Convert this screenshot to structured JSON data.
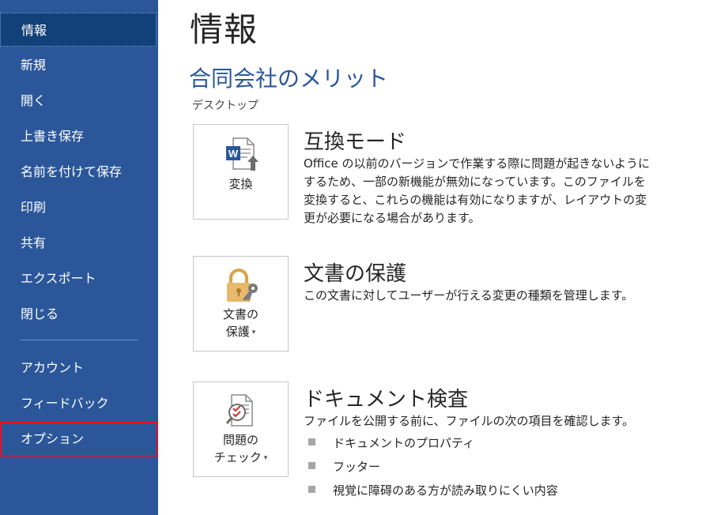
{
  "sidebar": {
    "items": [
      {
        "label": "情報"
      },
      {
        "label": "新規"
      },
      {
        "label": "開く"
      },
      {
        "label": "上書き保存"
      },
      {
        "label": "名前を付けて保存"
      },
      {
        "label": "印刷"
      },
      {
        "label": "共有"
      },
      {
        "label": "エクスポート"
      },
      {
        "label": "閉じる"
      },
      {
        "label": "アカウント"
      },
      {
        "label": "フィードバック"
      },
      {
        "label": "オプション"
      }
    ],
    "active_item": "情報",
    "highlighted_item": "オプション"
  },
  "main": {
    "page_title": "情報",
    "document_name": "合同会社のメリット",
    "document_location": "デスクトップ",
    "sections": [
      {
        "button_label": "変換",
        "button_icon": "word-convert-icon",
        "title": "互換モード",
        "description": "Office の以前のバージョンで作業する際に問題が起きないようにするため、一部の新機能が無効になっています。このファイルを変換すると、これらの機能は有効になりますが、レイアウトの変更が必要になる場合があります。"
      },
      {
        "button_label_line1": "文書の",
        "button_label_line2": "保護",
        "button_icon": "lock-key-icon",
        "title": "文書の保護",
        "description": "この文書に対してユーザーが行える変更の種類を管理します。"
      },
      {
        "button_label_line1": "問題の",
        "button_label_line2": "チェック",
        "button_icon": "inspect-document-icon",
        "title": "ドキュメント検査",
        "description": "ファイルを公開する前に、ファイルの次の項目を確認します。",
        "bullets": [
          "ドキュメントのプロパティ",
          "フッター",
          "視覚に障碍のある方が読み取りにくい内容"
        ]
      }
    ]
  },
  "colors": {
    "sidebar_bg": "#2b579a",
    "sidebar_active_bg": "#124078",
    "accent": "#2b579a",
    "highlight_border": "#e81123"
  }
}
